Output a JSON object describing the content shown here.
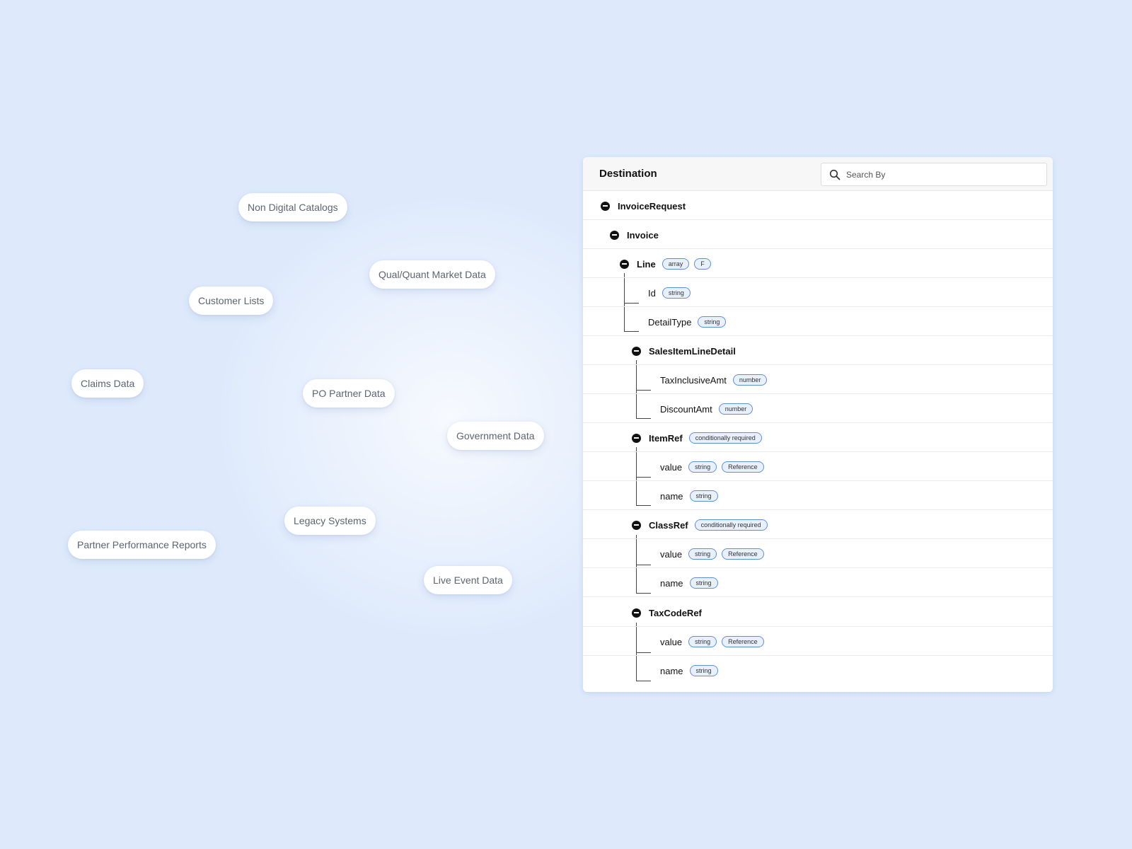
{
  "sources": [
    "Non Digital Catalogs",
    "Qual/Quant Market Data",
    "Customer Lists",
    "Claims Data",
    "PO Partner Data",
    "Government Data",
    "Legacy Systems",
    "Partner Performance Reports",
    "Live Event Data"
  ],
  "destination": {
    "title": "Destination",
    "search_placeholder": "Search By",
    "rows": [
      {
        "label": "InvoiceRequest",
        "bold": true,
        "toggle": true,
        "badges": []
      },
      {
        "label": "Invoice",
        "bold": true,
        "toggle": true,
        "badges": []
      },
      {
        "label": "Line",
        "bold": true,
        "toggle": true,
        "badges": [
          "array",
          "F"
        ]
      },
      {
        "label": "Id",
        "bold": false,
        "toggle": false,
        "badges": [
          "string"
        ]
      },
      {
        "label": "DetailType",
        "bold": false,
        "toggle": false,
        "badges": [
          "string"
        ]
      },
      {
        "label": "SalesItemLineDetail",
        "bold": true,
        "toggle": true,
        "badges": []
      },
      {
        "label": "TaxInclusiveAmt",
        "bold": false,
        "toggle": false,
        "badges": [
          "number"
        ]
      },
      {
        "label": "DiscountAmt",
        "bold": false,
        "toggle": false,
        "badges": [
          "number"
        ]
      },
      {
        "label": "ItemRef",
        "bold": true,
        "toggle": true,
        "badges": [
          "conditionally required"
        ]
      },
      {
        "label": "value",
        "bold": false,
        "toggle": false,
        "badges": [
          "string",
          "Reference"
        ]
      },
      {
        "label": "name",
        "bold": false,
        "toggle": false,
        "badges": [
          "string"
        ]
      },
      {
        "label": "ClassRef",
        "bold": true,
        "toggle": true,
        "badges": [
          "conditionally required"
        ]
      },
      {
        "label": "value",
        "bold": false,
        "toggle": false,
        "badges": [
          "string",
          "Reference"
        ]
      },
      {
        "label": "name",
        "bold": false,
        "toggle": false,
        "badges": [
          "string"
        ]
      },
      {
        "label": "TaxCodeRef",
        "bold": true,
        "toggle": true,
        "badges": []
      },
      {
        "label": "value",
        "bold": false,
        "toggle": false,
        "badges": [
          "string",
          "Reference"
        ]
      },
      {
        "label": "name",
        "bold": false,
        "toggle": false,
        "badges": [
          "string"
        ]
      }
    ]
  }
}
